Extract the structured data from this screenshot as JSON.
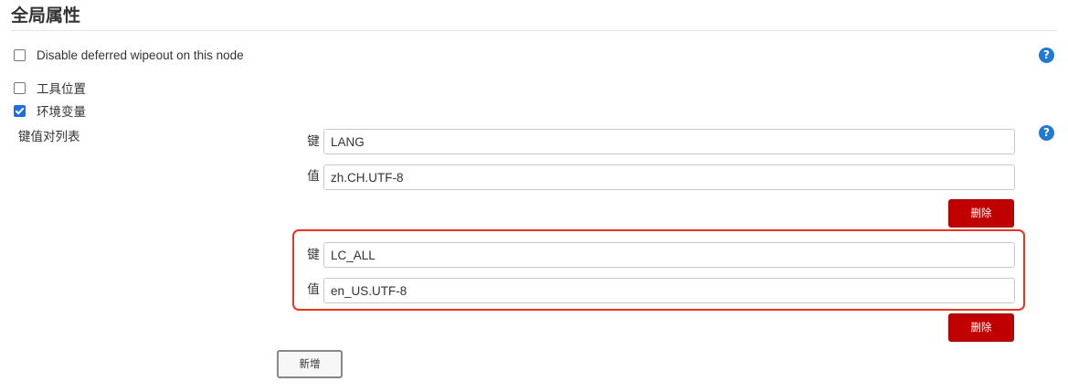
{
  "section": {
    "title": "全局属性"
  },
  "options": {
    "disable_wipeout": {
      "label": "Disable deferred wipeout on this node",
      "checked": false
    },
    "tool_locations": {
      "label": "工具位置",
      "checked": false
    },
    "env_vars": {
      "label": "环境变量",
      "checked": true
    }
  },
  "env": {
    "list_label": "键值对列表",
    "key_label": "键",
    "value_label": "值",
    "delete_label": "删除",
    "add_label": "新增",
    "entries": [
      {
        "key": "LANG",
        "value": "zh.CH.UTF-8"
      },
      {
        "key": "LC_ALL",
        "value": "en_US.UTF-8"
      }
    ]
  },
  "help_icon_glyph": "?",
  "icons": {
    "help": "help-icon",
    "checkbox": "checkbox"
  },
  "colors": {
    "accent_blue": "#1e7ad3",
    "delete_red": "#c00000",
    "highlight": "#e8361e"
  }
}
